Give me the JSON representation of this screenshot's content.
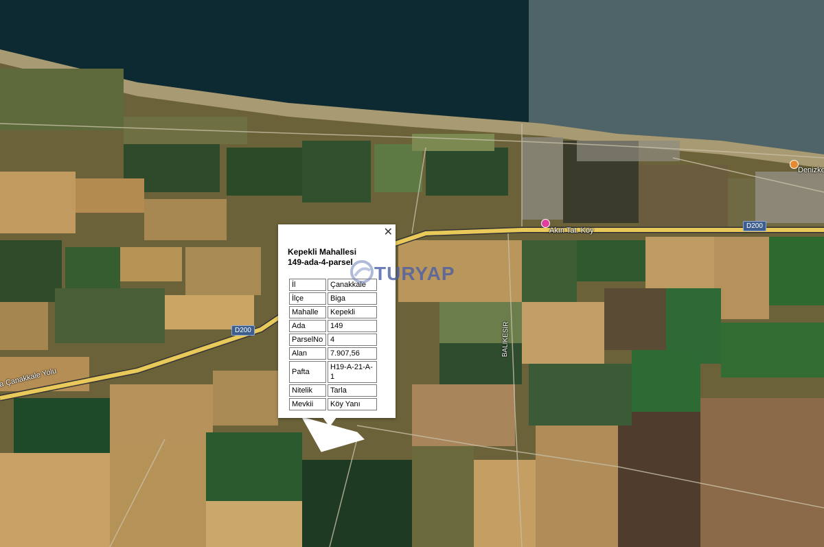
{
  "map": {
    "roads": {
      "d200_west": "D200",
      "d200_east": "D200",
      "canakkale_yolu": "a Çanakkale Yolu",
      "balikesir": "BALIKESİR"
    },
    "pois": {
      "akin_tat_koy": "Akın Tat. Köy",
      "denizkent": "Denizke"
    },
    "watermark": "TURYAP",
    "colors": {
      "sea": "#0d2a33",
      "road": "#e8c95a",
      "popup_bg": "#ffffff",
      "watermark": "#4a5fa6"
    }
  },
  "popup": {
    "close_icon": "✕",
    "title_line1": "Kepekli Mahallesi",
    "title_line2": "149-ada-4-parsel",
    "rows": [
      {
        "key": "İl",
        "value": "Çanakkale"
      },
      {
        "key": "İlçe",
        "value": "Biga"
      },
      {
        "key": "Mahalle",
        "value": "Kepekli"
      },
      {
        "key": "Ada",
        "value": "149"
      },
      {
        "key": "ParselNo",
        "value": "4"
      },
      {
        "key": "Alan",
        "value": "7.907,56"
      },
      {
        "key": "Pafta",
        "value": "H19-A-21-A-1"
      },
      {
        "key": "Nitelik",
        "value": "Tarla"
      },
      {
        "key": "Mevkii",
        "value": "Köy Yanı"
      }
    ]
  }
}
